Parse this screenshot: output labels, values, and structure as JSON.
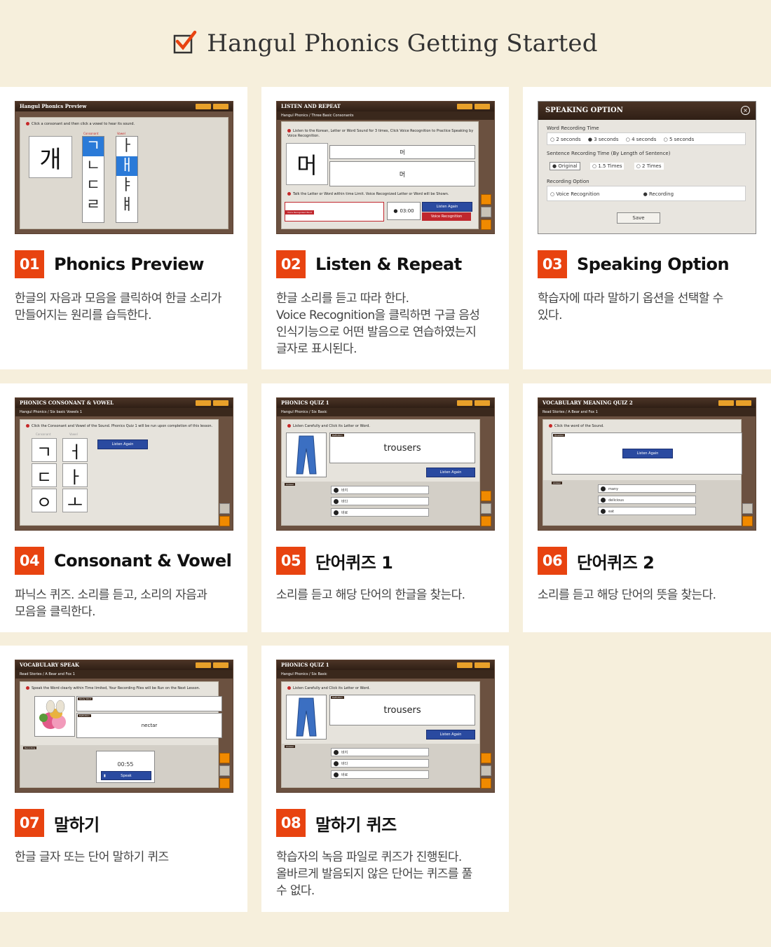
{
  "header": {
    "title": "Hangul Phonics Getting Started"
  },
  "cards": [
    {
      "num": "01",
      "title": "Phonics Preview",
      "desc": "한글의 자음과 모음을 클릭하여 한글 소리가\n만들어지는 원리를 습득한다.",
      "shot": {
        "bar": "Hangul Phonics Preview",
        "instruction": "Click a consonant and then click  a vowel to hear its sound.",
        "big": "개",
        "consonant_label": "Consonant",
        "vowel_label": "Vowel",
        "consonants": [
          "ㄱ",
          "ㄴ",
          "ㄷ",
          "ㄹ"
        ],
        "vowels": [
          "ㅏ",
          "ㅐ",
          "ㅑ",
          "ㅒ"
        ]
      }
    },
    {
      "num": "02",
      "title": "Listen & Repeat",
      "desc": "한글 소리를 듣고 따라 한다.\nVoice Recognition을 클릭하면 구글 음성\n인식기능으로 어떤 발음으로 연습하였는지\n글자로 표시된다.",
      "shot": {
        "bar": "LISTEN AND REPEAT",
        "sub": "Hangul Phonics / Three Basic Consonants",
        "instruction": "Listen to the Korean, Letter or Word Sound for 3 times, Click Voice Recognition to Practice Speaking by Voice Recognition.",
        "big": "머",
        "study_word": "머",
        "definition": "머",
        "instruction2": "Talk the Letter or Word within time Limit. Voice Recognized Letter or Word will be Shown.",
        "recognized_label": "Voice Recognized Word",
        "timer": "03:00",
        "listen": "Listen Again",
        "voice": "Voice Recognition"
      }
    },
    {
      "num": "03",
      "title": "Speaking Option",
      "desc": "학습자에 따라 말하기 옵션을 선택할 수\n있다.",
      "shot": {
        "bar": "SPEAKING OPTION",
        "word_time_label": "Word Recording Time",
        "word_times": [
          "2 seconds",
          "3 seconds",
          "4 seconds",
          "5 seconds"
        ],
        "sentence_label": "Sentence Recording Time (By Length of Sentence)",
        "sentence_opts": [
          "Original",
          "1.5 Times",
          "2 Times"
        ],
        "recording_label": "Recording Option",
        "recording_opts": [
          "Voice Recognition",
          "Recording"
        ],
        "save": "Save"
      }
    },
    {
      "num": "04",
      "title": "Consonant & Vowel",
      "desc": "파닉스 퀴즈. 소리를 듣고, 소리의 자음과\n모음을 클릭한다.",
      "shot": {
        "bar": "PHONICS CONSONANT & VOWEL",
        "sub": "Hangul Phonics / Six basic Vowels 1",
        "instruction": "Click the Consonant and Vowel of the Sound.   Phonics Quiz 1 will be run upon completion of this lesson.",
        "consonant_label": "Consonant",
        "vowel_label": "Vowel",
        "consonants": [
          "ㄱ",
          "ㄷ",
          "ㅇ"
        ],
        "vowels": [
          "ㅓ",
          "ㅏ",
          "ㅗ"
        ],
        "listen": "Listen Again"
      }
    },
    {
      "num": "05",
      "title": "단어퀴즈 1",
      "desc": "소리를 듣고 해당 단어의 한글을 찾는다.",
      "shot": {
        "bar": "PHONICS QUIZ 1",
        "sub": "Hangul Phonics / Six Basic",
        "instruction": "Listen Carefully and Click its Letter or Word.",
        "definition_label": "Definition",
        "word": "trousers",
        "listen": "Listen Again",
        "answer_label": "Answer",
        "answers": [
          "바지",
          "바다",
          "바로"
        ]
      }
    },
    {
      "num": "06",
      "title": "단어퀴즈 2",
      "desc": "소리를 듣고 해당 단어의 뜻을 찾는다.",
      "shot": {
        "bar": "VOCABULARY MEANING QUIZ 2",
        "sub": "Read Stories / A Bear and Fox 1",
        "instruction": "Click the word of the Sound.",
        "question_label": "Question",
        "listen": "Listen Again",
        "answer_label": "Answer",
        "answers": [
          "many",
          "delicious",
          "eat"
        ]
      }
    },
    {
      "num": "07",
      "title": "말하기",
      "desc": "한글 글자 또는 단어 말하기 퀴즈",
      "shot": {
        "bar": "VOCABULARY SPEAK",
        "sub": "Read Stories / A Bear and Fox 1",
        "instruction": "Speak the Word clearly within Time limited, Your Recording Files will be Run on the Next Lesson.",
        "study_label": "Study Word",
        "definition_label": "Definition",
        "word": "nectar",
        "recording_label": "Recording",
        "timer": "00:55",
        "speak": "Speak"
      }
    },
    {
      "num": "08",
      "title": "말하기 퀴즈",
      "desc": "학습자의 녹음 파일로 퀴즈가 진행된다.\n올바르게 발음되지 않은 단어는 퀴즈를 풀\n수 없다.",
      "shot": {
        "bar": "PHONICS QUIZ 1",
        "sub": "Hangul Phonics / Six Basic",
        "instruction": "Listen Carefully and Click its Letter or Word.",
        "definition_label": "Definition",
        "word": "trousers",
        "listen": "Listen Again",
        "answer_label": "Answer",
        "answers": [
          "바지",
          "바다",
          "바로"
        ]
      }
    }
  ],
  "colors": {
    "badge": "#e84310",
    "bg": "#f6efdc",
    "title_text": "#111111",
    "desc_text": "#444444",
    "accent_blue": "#2a4aa0"
  }
}
